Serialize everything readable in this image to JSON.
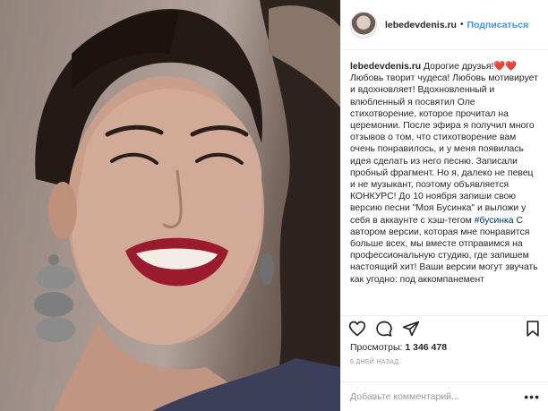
{
  "header": {
    "username": "lebedevdenis.ru",
    "separator": "•",
    "follow_label": "Подписаться"
  },
  "caption": {
    "username": "lebedevdenis.ru",
    "text_1": "Дорогие друзья!❤️❤️ Любовь творит чудеса! Любовь мотивирует и вдохновляет! Вдохновленный и влюбленный я посвятил Оле стихотворение, которое прочитал на церемонии. После эфира я получил много отзывов о том, что стихотворение вам очень понравилось, и у меня появилась идея сделать из него песню. Записали пробный фрагмент. Но я, далеко не певец и не музыкант, поэтому объявляется КОНКУРС! До 10 ноября запиши свою версию песни \"Моя Бусинка\" и выложи у себя в аккаунте с хэш-тегом",
    "hashtag": "#бусинка",
    "text_2": "С автором версии, которая мне понравится больше всех, мы вместе отправимся на профессиональную студию, где запишем настоящий хит! Ваши версии могут звучать как угодно: под аккомпанемент"
  },
  "actions": {
    "icons": [
      "heart-icon",
      "comment-icon",
      "share-icon",
      "bookmark-icon"
    ]
  },
  "stats": {
    "views_label": "Просмотры:",
    "views_count": "1 346 478",
    "time_ago": "6 дней назад"
  },
  "comment": {
    "placeholder": "Добавьте комментарий...",
    "more_label": "•••"
  },
  "colors": {
    "link_blue": "#3897f0",
    "hashtag": "#003569",
    "text": "#262626",
    "muted": "#999999",
    "lipstick": "#9b1b2e"
  }
}
